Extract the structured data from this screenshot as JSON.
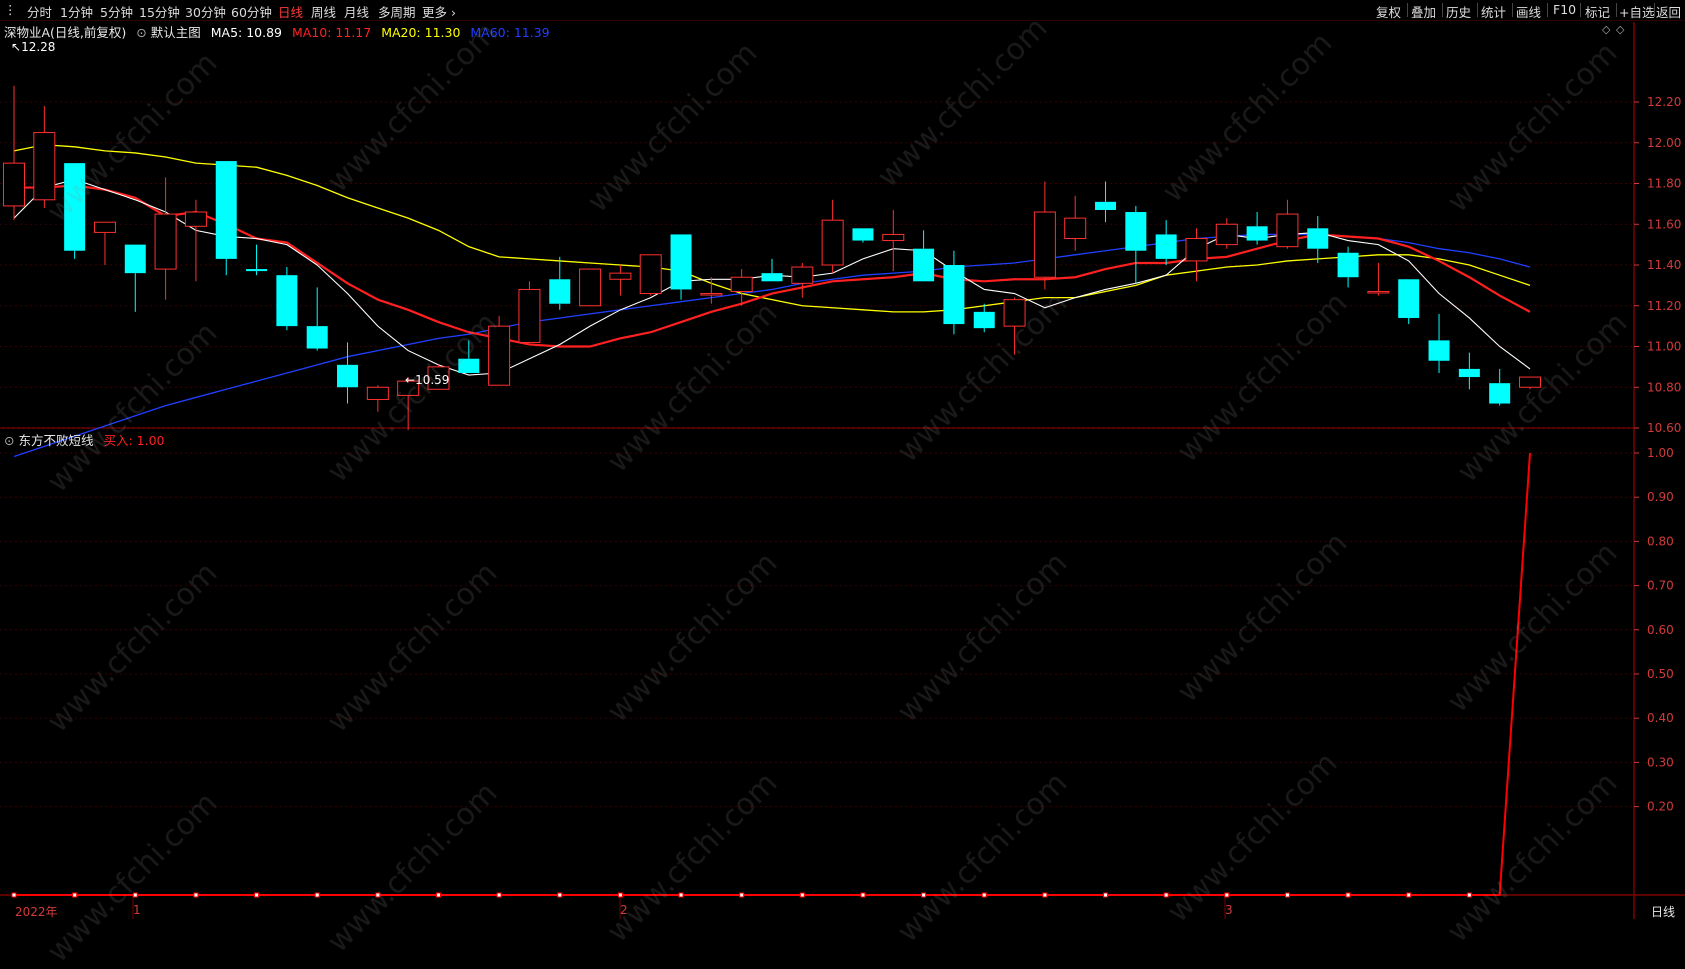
{
  "toolbar": {
    "period_tabs": [
      "分时",
      "1分钟",
      "5分钟",
      "15分钟",
      "30分钟",
      "60分钟",
      "日线",
      "周线",
      "月线",
      "多周期",
      "更多 ›"
    ],
    "active_tab": "日线",
    "right_buttons": [
      "复权",
      "叠加",
      "历史",
      "统计",
      "画线",
      "F10",
      "+自选",
      "返回"
    ],
    "mark_button": "标记",
    "period_indicator": "日线"
  },
  "main_panel": {
    "stock_label": "深物业A(日线,前复权)",
    "template_label": "默认主图",
    "ma": [
      {
        "label": "MA5: 10.89",
        "color": "#ffffff"
      },
      {
        "label": "MA10: 11.17",
        "color": "#ff2020"
      },
      {
        "label": "MA20: 11.30",
        "color": "#ffff00"
      },
      {
        "label": "MA60: 11.39",
        "color": "#2040ff"
      }
    ],
    "high_label": "12.28",
    "low_label": "10.59",
    "up_color": "#ff3030",
    "down_color": "#00ffff"
  },
  "sub_panel": {
    "indicator_label": "东方不败短线",
    "value_label": "买入: 1.00",
    "line_color": "#ff0000"
  },
  "date_axis": {
    "labels": [
      "2022年",
      "1",
      "2",
      "3"
    ]
  },
  "watermark": "www.cfchi.com",
  "chart_data": [
    {
      "type": "candlestick",
      "title": "深物业A(日线,前复权)",
      "y_ticks": [
        12.2,
        12.0,
        11.8,
        11.6,
        11.4,
        11.2,
        11.0,
        10.8,
        10.6
      ],
      "ylim": [
        10.46,
        12.4
      ],
      "candles": [
        {
          "o": 11.69,
          "h": 12.28,
          "l": 11.62,
          "c": 11.9
        },
        {
          "o": 11.72,
          "h": 12.18,
          "l": 11.68,
          "c": 12.05
        },
        {
          "o": 11.9,
          "h": 11.9,
          "l": 11.43,
          "c": 11.47
        },
        {
          "o": 11.56,
          "h": 11.6,
          "l": 11.4,
          "c": 11.61
        },
        {
          "o": 11.5,
          "h": 11.5,
          "l": 11.17,
          "c": 11.36
        },
        {
          "o": 11.38,
          "h": 11.83,
          "l": 11.23,
          "c": 11.65
        },
        {
          "o": 11.59,
          "h": 11.72,
          "l": 11.32,
          "c": 11.66
        },
        {
          "o": 11.91,
          "h": 11.91,
          "l": 11.35,
          "c": 11.43
        },
        {
          "o": 11.38,
          "h": 11.5,
          "l": 11.35,
          "c": 11.37
        },
        {
          "o": 11.35,
          "h": 11.39,
          "l": 11.08,
          "c": 11.1
        },
        {
          "o": 11.1,
          "h": 11.29,
          "l": 10.98,
          "c": 10.99
        },
        {
          "o": 10.91,
          "h": 11.02,
          "l": 10.72,
          "c": 10.8
        },
        {
          "o": 10.74,
          "h": 10.81,
          "l": 10.68,
          "c": 10.8
        },
        {
          "o": 10.76,
          "h": 10.85,
          "l": 10.59,
          "c": 10.83
        },
        {
          "o": 10.79,
          "h": 10.91,
          "l": 10.79,
          "c": 10.9
        },
        {
          "o": 10.94,
          "h": 11.03,
          "l": 10.87,
          "c": 10.87
        },
        {
          "o": 10.81,
          "h": 11.15,
          "l": 10.81,
          "c": 11.1
        },
        {
          "o": 11.02,
          "h": 11.32,
          "l": 11.02,
          "c": 11.28
        },
        {
          "o": 11.33,
          "h": 11.44,
          "l": 11.18,
          "c": 11.21
        },
        {
          "o": 11.2,
          "h": 11.38,
          "l": 11.2,
          "c": 11.38
        },
        {
          "o": 11.33,
          "h": 11.4,
          "l": 11.25,
          "c": 11.36
        },
        {
          "o": 11.26,
          "h": 11.45,
          "l": 11.25,
          "c": 11.45
        },
        {
          "o": 11.55,
          "h": 11.55,
          "l": 11.23,
          "c": 11.28
        },
        {
          "o": 11.26,
          "h": 11.34,
          "l": 11.21,
          "c": 11.26
        },
        {
          "o": 11.27,
          "h": 11.38,
          "l": 11.2,
          "c": 11.34
        },
        {
          "o": 11.36,
          "h": 11.43,
          "l": 11.32,
          "c": 11.32
        },
        {
          "o": 11.31,
          "h": 11.41,
          "l": 11.24,
          "c": 11.39
        },
        {
          "o": 11.4,
          "h": 11.72,
          "l": 11.36,
          "c": 11.62
        },
        {
          "o": 11.58,
          "h": 11.58,
          "l": 11.51,
          "c": 11.52
        },
        {
          "o": 11.52,
          "h": 11.67,
          "l": 11.37,
          "c": 11.55
        },
        {
          "o": 11.48,
          "h": 11.57,
          "l": 11.32,
          "c": 11.32
        },
        {
          "o": 11.4,
          "h": 11.47,
          "l": 11.06,
          "c": 11.11
        },
        {
          "o": 11.17,
          "h": 11.21,
          "l": 11.07,
          "c": 11.09
        },
        {
          "o": 11.1,
          "h": 11.24,
          "l": 10.96,
          "c": 11.23
        },
        {
          "o": 11.34,
          "h": 11.81,
          "l": 11.28,
          "c": 11.66
        },
        {
          "o": 11.53,
          "h": 11.74,
          "l": 11.47,
          "c": 11.63
        },
        {
          "o": 11.71,
          "h": 11.81,
          "l": 11.61,
          "c": 11.67
        },
        {
          "o": 11.66,
          "h": 11.69,
          "l": 11.31,
          "c": 11.47
        },
        {
          "o": 11.55,
          "h": 11.62,
          "l": 11.4,
          "c": 11.43
        },
        {
          "o": 11.42,
          "h": 11.58,
          "l": 11.32,
          "c": 11.53
        },
        {
          "o": 11.5,
          "h": 11.63,
          "l": 11.48,
          "c": 11.6
        },
        {
          "o": 11.59,
          "h": 11.66,
          "l": 11.5,
          "c": 11.52
        },
        {
          "o": 11.49,
          "h": 11.72,
          "l": 11.48,
          "c": 11.65
        },
        {
          "o": 11.58,
          "h": 11.64,
          "l": 11.41,
          "c": 11.48
        },
        {
          "o": 11.46,
          "h": 11.49,
          "l": 11.29,
          "c": 11.34
        },
        {
          "o": 11.27,
          "h": 11.41,
          "l": 11.25,
          "c": 11.27
        },
        {
          "o": 11.33,
          "h": 11.33,
          "l": 11.11,
          "c": 11.14
        },
        {
          "o": 11.03,
          "h": 11.16,
          "l": 10.87,
          "c": 10.93
        },
        {
          "o": 10.89,
          "h": 10.97,
          "l": 10.79,
          "c": 10.85
        },
        {
          "o": 10.82,
          "h": 10.89,
          "l": 10.71,
          "c": 10.72
        },
        {
          "o": 10.8,
          "h": 10.85,
          "l": 10.79,
          "c": 10.85
        }
      ],
      "ma5": [
        11.63,
        11.78,
        11.82,
        11.77,
        11.72,
        11.66,
        11.57,
        11.54,
        11.53,
        11.5,
        11.4,
        11.26,
        11.1,
        10.98,
        10.91,
        10.86,
        10.87,
        10.94,
        11.01,
        11.1,
        11.18,
        11.24,
        11.32,
        11.33,
        11.33,
        11.35,
        11.34,
        11.36,
        11.43,
        11.48,
        11.47,
        11.37,
        11.28,
        11.26,
        11.19,
        11.24,
        11.28,
        11.31,
        11.35,
        11.48,
        11.55,
        11.53,
        11.55,
        11.56,
        11.52,
        11.5,
        11.42,
        11.26,
        11.14,
        11.0,
        10.89
      ],
      "ma10": [
        11.78,
        11.78,
        11.79,
        11.77,
        11.73,
        11.64,
        11.66,
        11.6,
        11.53,
        11.51,
        11.41,
        11.31,
        11.23,
        11.18,
        11.12,
        11.07,
        11.04,
        11.01,
        11.0,
        11.0,
        11.04,
        11.07,
        11.12,
        11.17,
        11.21,
        11.26,
        11.29,
        11.32,
        11.33,
        11.34,
        11.36,
        11.33,
        11.32,
        11.33,
        11.33,
        11.34,
        11.38,
        11.41,
        11.41,
        11.43,
        11.44,
        11.48,
        11.52,
        11.55,
        11.54,
        11.53,
        11.49,
        11.42,
        11.34,
        11.25,
        11.17
      ],
      "ma20": [
        11.96,
        11.99,
        11.98,
        11.96,
        11.95,
        11.93,
        11.9,
        11.89,
        11.88,
        11.84,
        11.79,
        11.73,
        11.68,
        11.63,
        11.57,
        11.49,
        11.44,
        11.43,
        11.42,
        11.41,
        11.4,
        11.39,
        11.37,
        11.31,
        11.26,
        11.23,
        11.2,
        11.19,
        11.18,
        11.17,
        11.17,
        11.18,
        11.2,
        11.22,
        11.24,
        11.24,
        11.27,
        11.3,
        11.35,
        11.37,
        11.39,
        11.4,
        11.42,
        11.43,
        11.44,
        11.45,
        11.45,
        11.43,
        11.4,
        11.35,
        11.3
      ],
      "ma60": [
        10.46,
        10.51,
        10.56,
        10.61,
        10.66,
        10.71,
        10.75,
        10.79,
        10.83,
        10.87,
        10.91,
        10.95,
        10.98,
        11.01,
        11.04,
        11.06,
        11.09,
        11.12,
        11.14,
        11.16,
        11.18,
        11.2,
        11.22,
        11.24,
        11.26,
        11.28,
        11.31,
        11.33,
        11.35,
        11.36,
        11.37,
        11.39,
        11.4,
        11.41,
        11.43,
        11.45,
        11.47,
        11.49,
        11.51,
        11.53,
        11.54,
        11.55,
        11.55,
        11.55,
        11.54,
        11.53,
        11.51,
        11.48,
        11.46,
        11.43,
        11.39
      ]
    },
    {
      "type": "line",
      "title": "东方不败短线",
      "y_ticks": [
        1.0,
        0.9,
        0.8,
        0.7,
        0.6,
        0.5,
        0.4,
        0.3,
        0.2
      ],
      "ylim": [
        0,
        1.0
      ],
      "series": [
        {
          "name": "买入",
          "values": [
            0,
            0,
            0,
            0,
            0,
            0,
            0,
            0,
            0,
            0,
            0,
            0,
            0,
            0,
            0,
            0,
            0,
            0,
            0,
            0,
            0,
            0,
            0,
            0,
            0,
            0,
            0,
            0,
            0,
            0,
            0,
            0,
            0,
            0,
            0,
            0,
            0,
            0,
            0,
            0,
            0,
            0,
            0,
            0,
            0,
            0,
            0,
            0,
            0,
            0,
            1
          ]
        }
      ]
    }
  ]
}
